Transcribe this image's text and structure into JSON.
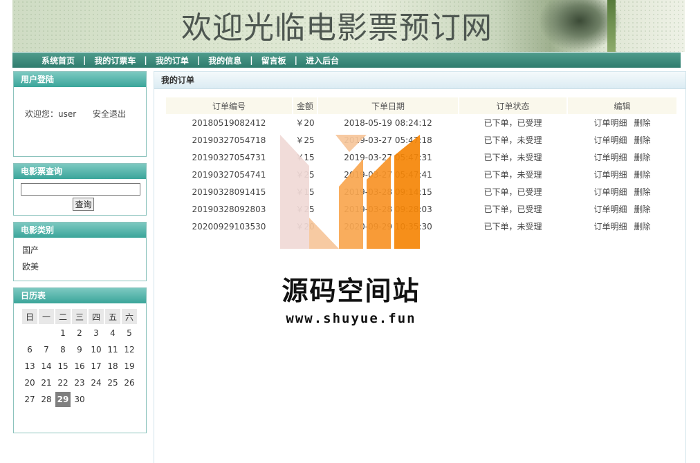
{
  "banner": {
    "title": "欢迎光临电影票预订网"
  },
  "nav": {
    "items": [
      "系统首页",
      "我的订票车",
      "我的订单",
      "我的信息",
      "留言板",
      "进入后台"
    ],
    "separator": "|"
  },
  "login": {
    "header": "用户登陆",
    "welcome": "欢迎您：user",
    "logout": "安全退出"
  },
  "search": {
    "header": "电影票查询",
    "input_value": "",
    "button_label": "查询"
  },
  "categories": {
    "header": "电影类别",
    "items": [
      "国产",
      "欧美"
    ]
  },
  "calendar": {
    "header": "日历表",
    "weekdays": [
      "日",
      "一",
      "二",
      "三",
      "四",
      "五",
      "六"
    ],
    "weeks": [
      [
        "",
        "",
        "1",
        "2",
        "3",
        "4",
        "5"
      ],
      [
        "6",
        "7",
        "8",
        "9",
        "10",
        "11",
        "12"
      ],
      [
        "13",
        "14",
        "15",
        "16",
        "17",
        "18",
        "19"
      ],
      [
        "20",
        "21",
        "22",
        "23",
        "24",
        "25",
        "26"
      ],
      [
        "27",
        "28",
        "29",
        "30",
        "",
        "",
        ""
      ]
    ],
    "today": "29"
  },
  "orders": {
    "header": "我的订单",
    "columns": [
      "订单编号",
      "金额",
      "下单日期",
      "订单状态",
      "编辑"
    ],
    "actions": [
      "订单明细",
      "删除"
    ],
    "rows": [
      [
        "20180519082412",
        "￥20",
        "2018-05-19 08:24:12",
        "已下单，已受理"
      ],
      [
        "20190327054718",
        "￥25",
        "2019-03-27 05:47:18",
        "已下单，未受理"
      ],
      [
        "20190327054731",
        "￥15",
        "2019-03-27 05:47:31",
        "已下单，未受理"
      ],
      [
        "20190327054741",
        "￥25",
        "2019-03-27 05:47:41",
        "已下单，未受理"
      ],
      [
        "20190328091415",
        "￥15",
        "2019-03-28 09:14:15",
        "已下单，已受理"
      ],
      [
        "20190328092803",
        "￥25",
        "2019-03-28 09:28:03",
        "已下单，已受理"
      ],
      [
        "20200929103530",
        "￥20",
        "2020-09-29 10:35:30",
        "已下单，未受理"
      ]
    ]
  },
  "watermark": {
    "title": "源码空间站",
    "url": "www.shuyue.fun",
    "colors": [
      "#f0d9d6",
      "#f6c59a",
      "#f8a64f",
      "#f79226",
      "#f58506"
    ]
  }
}
